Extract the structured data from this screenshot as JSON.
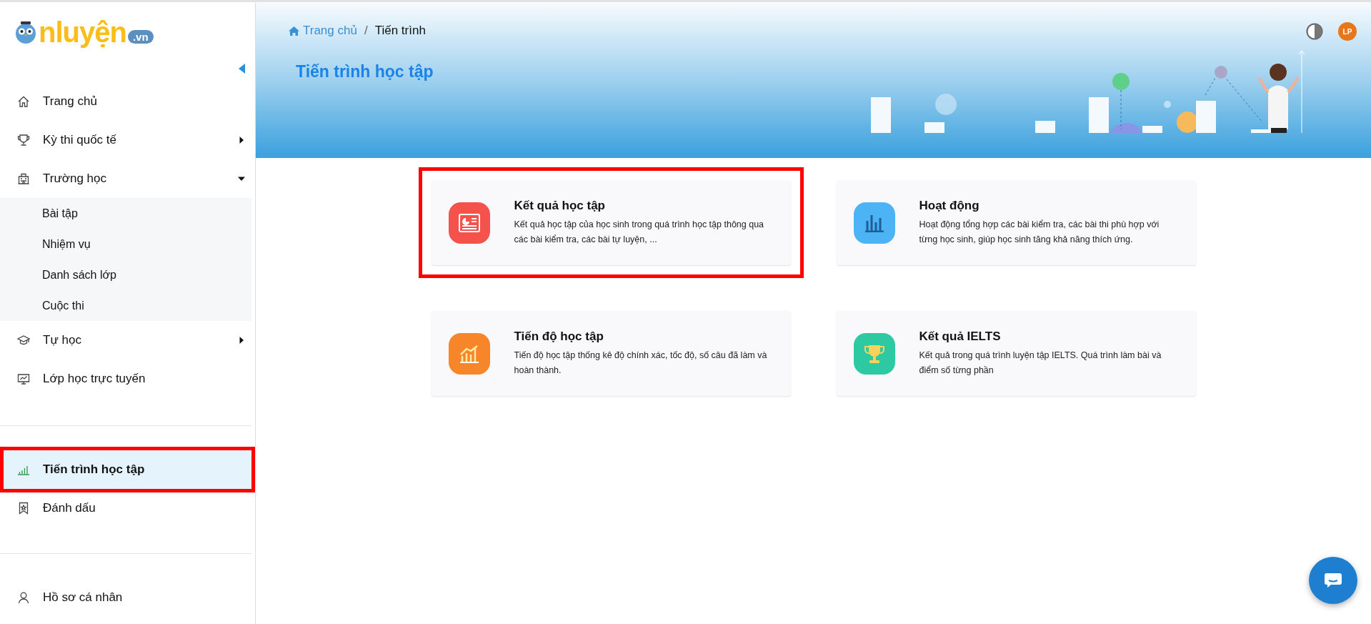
{
  "logo": {
    "text": "nluyện",
    "suffix": ".vn"
  },
  "sidebar": {
    "sections": [
      {
        "items": [
          {
            "label": "Trang chủ",
            "selected": false,
            "highlighted": false
          },
          {
            "label": "Kỳ thi quốc tế",
            "selected": false,
            "highlighted": false,
            "expanded": false
          },
          {
            "label": "Trường học",
            "selected": false,
            "highlighted": false,
            "expanded": true,
            "children": [
              {
                "label": "Bài tập"
              },
              {
                "label": "Nhiệm vụ"
              },
              {
                "label": "Danh sách lớp"
              },
              {
                "label": "Cuộc thi"
              }
            ]
          },
          {
            "label": "Tự học",
            "selected": false,
            "highlighted": false,
            "expanded": false
          },
          {
            "label": "Lớp học trực tuyến",
            "selected": false,
            "highlighted": false
          }
        ]
      },
      {
        "items": [
          {
            "label": "Tiến trình học tập",
            "selected": true,
            "highlighted": true
          },
          {
            "label": "Đánh dấu",
            "selected": false,
            "highlighted": false
          }
        ]
      },
      {
        "items": [
          {
            "label": "Hồ sơ cá nhân",
            "selected": false,
            "highlighted": false
          }
        ]
      }
    ]
  },
  "breadcrumb": [
    {
      "label": "Trang chủ"
    },
    {
      "label": "Tiến trình"
    }
  ],
  "breadcrumb_separator": "/",
  "page_title": "Tiến trình học tập",
  "avatar": {
    "initials": "LP"
  },
  "cards": [
    {
      "title": "Kết quả học tập",
      "description": "Kết quả học tập của học sinh trong quá trình học tập thông qua các bài kiểm tra, các bài tự luyện, ...",
      "color": "#f5524b",
      "highlighted": true
    },
    {
      "title": "Hoạt động",
      "description": "Hoạt động tổng hợp các bài kiểm tra, các bài thi phù hợp với từng học sinh, giúp học sinh tăng khả năng thích ứng.",
      "color": "#4cb3f4",
      "highlighted": false
    },
    {
      "title": "Tiến độ học tập",
      "description": "Tiến độ học tập thống kê độ chính xác, tốc độ, số câu đã làm và hoàn thành.",
      "color": "#f7862a",
      "highlighted": false
    },
    {
      "title": "Kết quả IELTS",
      "description": "Kết quả trong quá trình luyện tập IELTS. Quá trình làm bài và điểm số từng phần",
      "color": "#2dc9a3",
      "highlighted": false
    }
  ]
}
